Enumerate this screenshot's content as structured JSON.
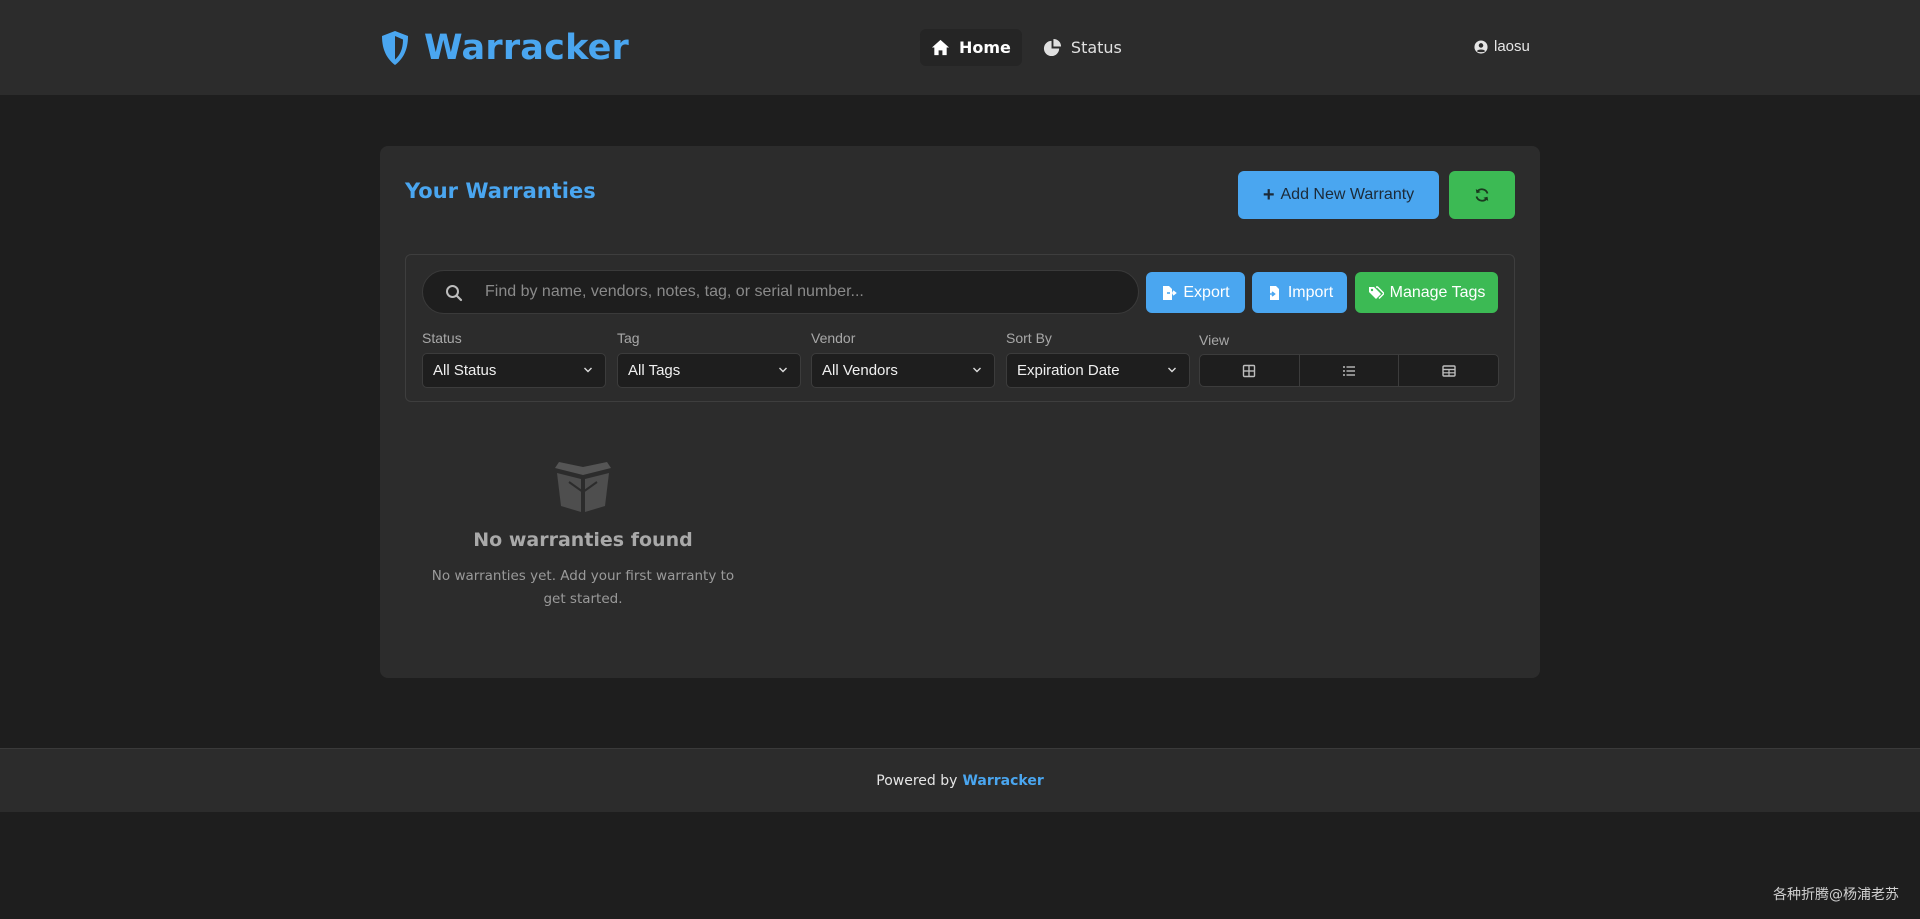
{
  "header": {
    "brand": "Warracker",
    "nav": [
      {
        "label": "Home",
        "icon": "home-icon",
        "active": true
      },
      {
        "label": "Status",
        "icon": "pie-chart-icon",
        "active": false
      }
    ],
    "user": "laosu"
  },
  "main": {
    "title": "Your Warranties",
    "add_button": "Add New Warranty",
    "refresh_icon": "refresh-icon",
    "search_placeholder": "Find by name, vendors, notes, tag, or serial number...",
    "export_label": "Export",
    "import_label": "Import",
    "manage_tags_label": "Manage Tags",
    "filters": {
      "status": {
        "label": "Status",
        "value": "All Status"
      },
      "tag": {
        "label": "Tag",
        "value": "All Tags"
      },
      "vendor": {
        "label": "Vendor",
        "value": "All Vendors"
      },
      "sort": {
        "label": "Sort By",
        "value": "Expiration Date"
      },
      "view": {
        "label": "View",
        "options": [
          "grid-view-icon",
          "list-view-icon",
          "table-view-icon"
        ]
      }
    },
    "empty_state": {
      "icon": "box-open-icon",
      "title": "No warranties found",
      "text": "No warranties yet. Add your first warranty to get started."
    }
  },
  "footer": {
    "text": "Powered by",
    "link": "Warracker"
  },
  "watermark": "各种折腾@杨浦老苏",
  "colors": {
    "accent": "#4aa6f0",
    "success": "#3cba54",
    "background": "#1e1e1e",
    "surface": "#2c2c2c"
  }
}
